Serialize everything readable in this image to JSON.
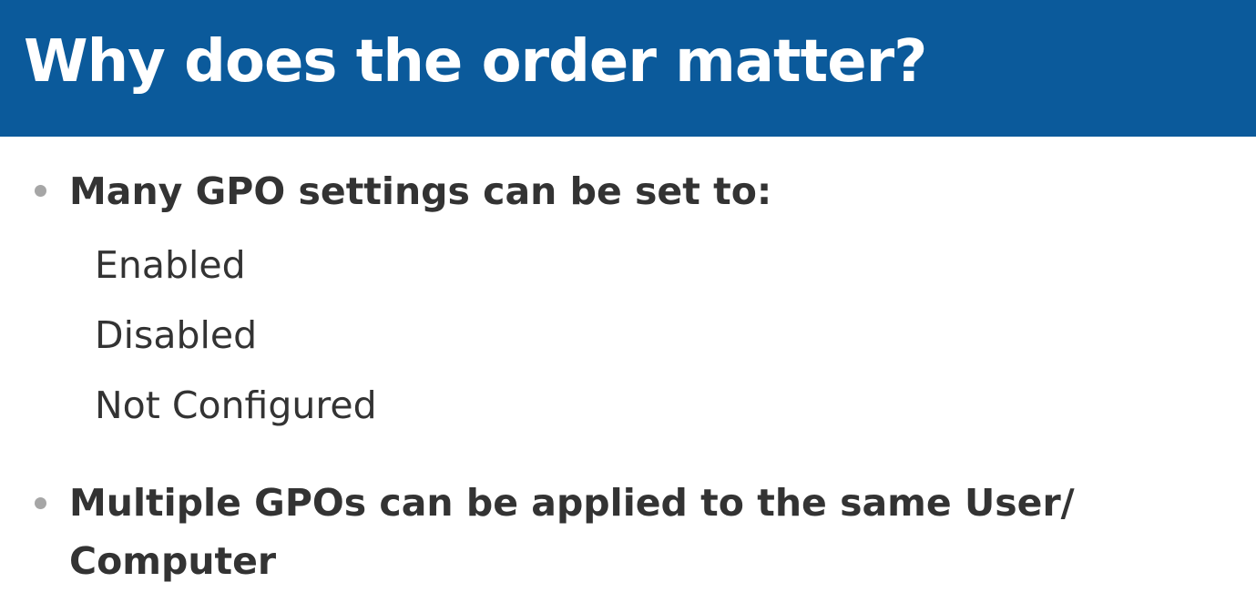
{
  "slide": {
    "title": "Why does the order matter?",
    "bullets": [
      {
        "text": "Many GPO settings can be set to:",
        "sub_items": [
          "Enabled",
          "Disabled",
          "Not Configured"
        ]
      },
      {
        "line1": "Multiple GPOs can be applied to the same User/",
        "line2": "Computer"
      }
    ]
  },
  "colors": {
    "title_bar": "#0b5a9b",
    "title_text": "#ffffff",
    "body_text": "#333333",
    "bullet_dot": "#a6a6a6"
  }
}
